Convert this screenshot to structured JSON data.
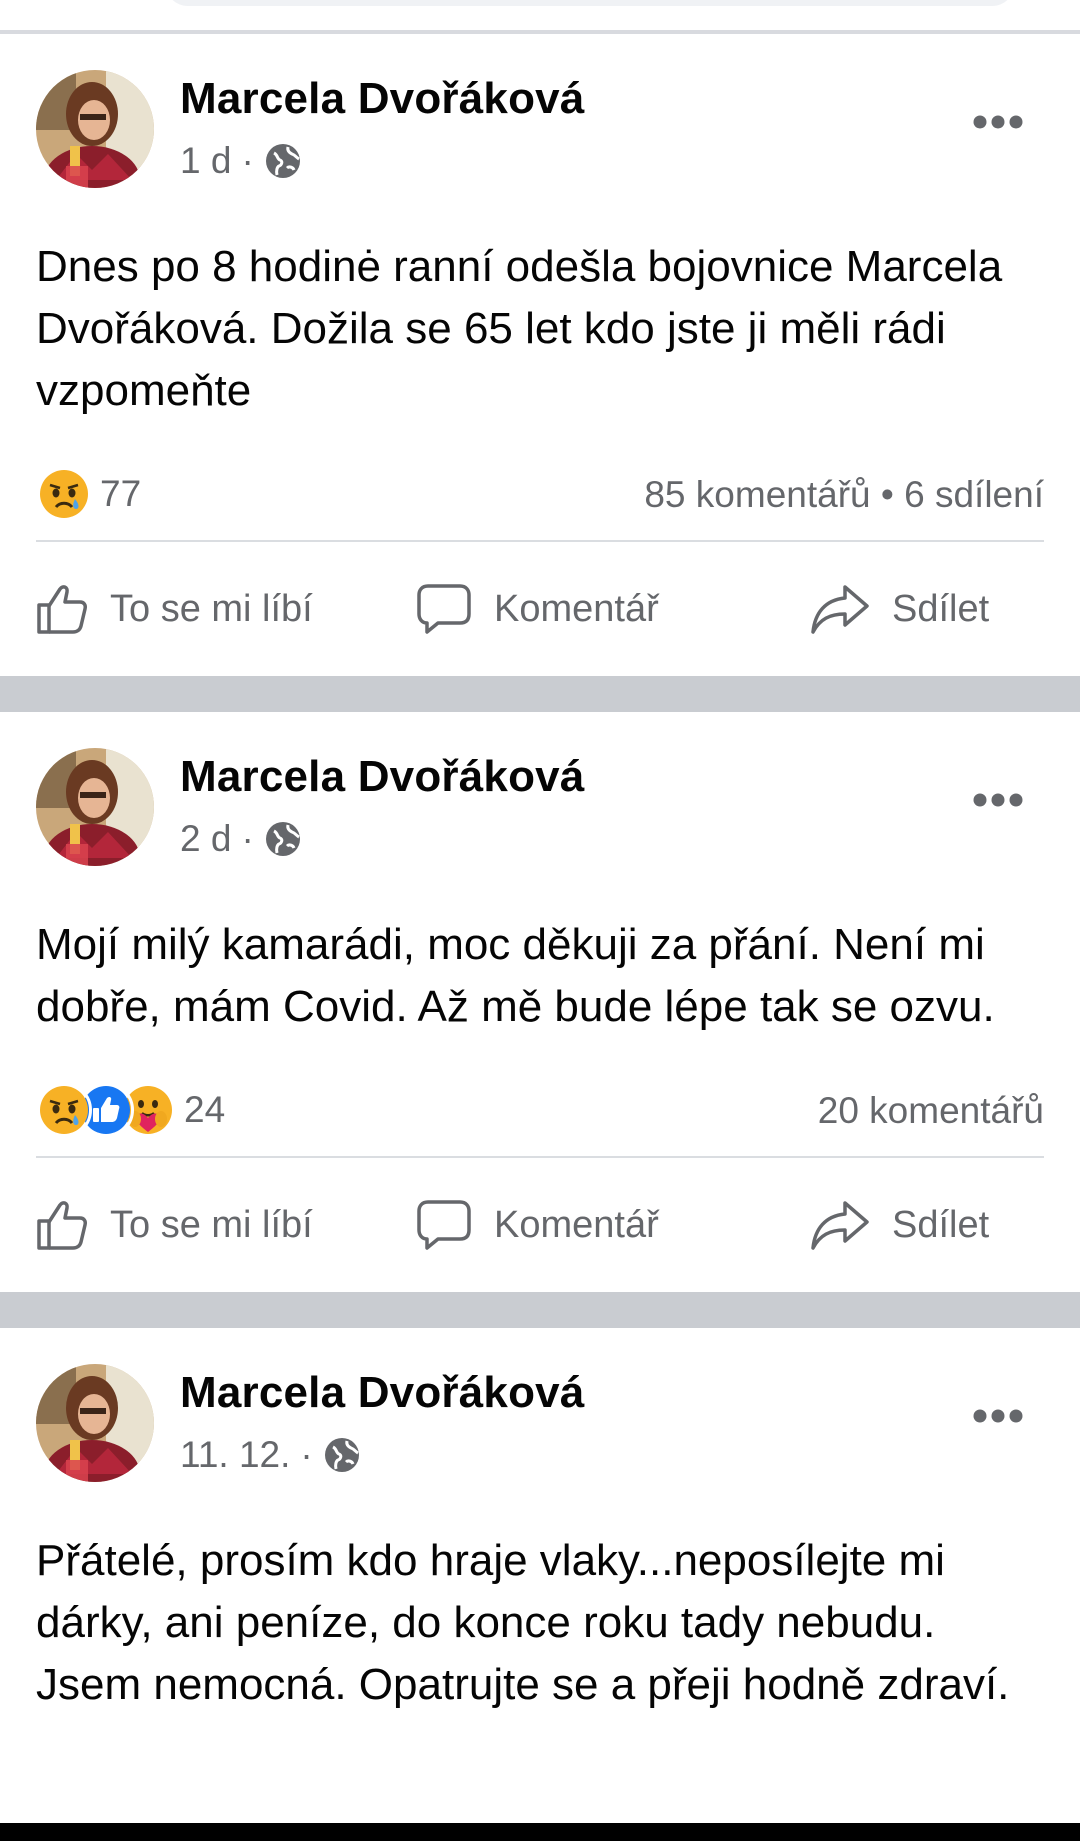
{
  "posts": [
    {
      "author": "Marcela Dvořáková",
      "time": "1 d",
      "dot": "·",
      "text": "Dnes po 8 hodinė ranní odešla bojovnice Marcela Dvořáková. Dožila se 65 let kdo jste ji měli rádi vzpomeňte",
      "reactions": [
        "sad"
      ],
      "reaction_count": "77",
      "counts": "85 komentářů • 6 sdílení"
    },
    {
      "author": "Marcela Dvořáková",
      "time": "2 d",
      "dot": "·",
      "text": "Mojí milý kamarádi, moc děkuji za přání. Není mi dobře, mám Covid. Až mě bude lépe tak se ozvu.",
      "reactions": [
        "sad",
        "like",
        "care"
      ],
      "reaction_count": "24",
      "counts": "20 komentářů"
    },
    {
      "author": "Marcela Dvořáková",
      "time": "11. 12.",
      "dot": "·",
      "text": "Přátelé, prosím kdo hraje vlaky...neposílejte mi dárky, ani peníze, do konce roku tady nebudu. Jsem nemocná. Opatrujte se a přeji hodně zdraví."
    }
  ],
  "actions": {
    "like": "To se mi líbí",
    "comment": "Komentář",
    "share": "Sdílet"
  },
  "icons": {
    "privacy": "globe-icon",
    "menu": "more-horizontal-icon",
    "like": "thumbs-up-outline-icon",
    "comment": "speech-bubble-icon",
    "share": "share-arrow-icon"
  },
  "colors": {
    "secondary_text": "#65676b",
    "primary_text": "#050505",
    "separator": "#c9ccd1",
    "like_blue": "#1877f2",
    "sad_yellow": "#f7b125"
  }
}
